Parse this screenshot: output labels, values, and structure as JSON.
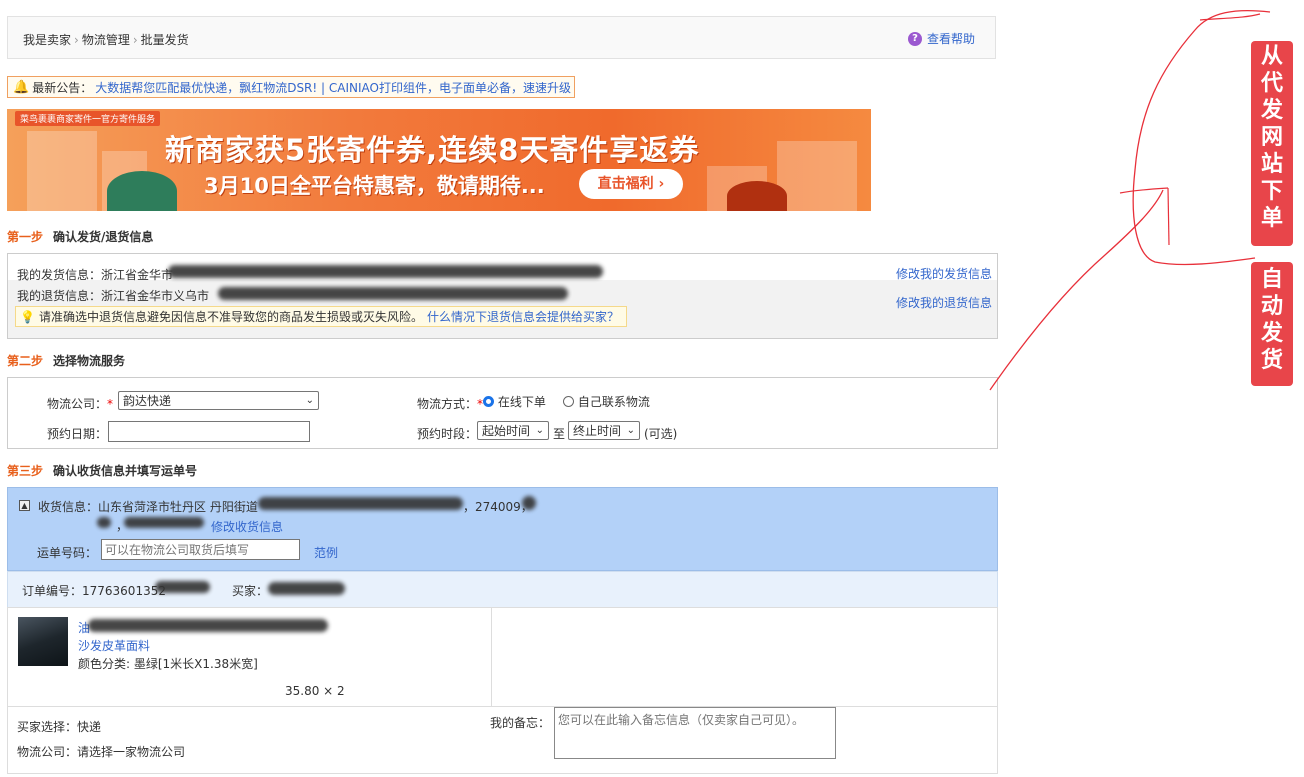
{
  "breadcrumb": [
    "我是卖家",
    "物流管理",
    "批量发货"
  ],
  "breadcrumb_sep": "›",
  "help": "查看帮助",
  "notice": {
    "prefix": "最新公告：",
    "text": "大数据帮您匹配最优快递，飘红物流DSR! | CAINIAO打印组件，电子面单必备，速速升级"
  },
  "banner": {
    "tag": "菜鸟裹裹商家寄件一官方寄件服务",
    "main": "新商家获5张寄件券,连续8天寄件享返券",
    "sub": "3月10日全平台特惠寄，敬请期待...",
    "button": "直击福利 ›"
  },
  "step1": {
    "num": "第一步",
    "title": "确认发货/退货信息",
    "ship_label": "我的发货信息：浙江省金华市",
    "return_label": "我的退货信息：浙江省金华市义乌市",
    "ship_edit": "修改我的发货信息",
    "return_edit": "修改我的退货信息",
    "tip": "请准确选中退货信息避免因信息不准导致您的商品发生损毁或灭失风险。",
    "tip_link": "什么情况下退货信息会提供给买家？"
  },
  "step2": {
    "num": "第二步",
    "title": "选择物流服务",
    "company_label": "物流公司：",
    "company_value": "韵达快递",
    "method_label": "物流方式：",
    "method_online": "在线下单",
    "method_self": "自己联系物流",
    "date_label": "预约日期：",
    "time_label": "预约时段：",
    "time_start": "起始时间",
    "time_to": "至",
    "time_end": "终止时间",
    "time_optional": "(可选)",
    "req": "*"
  },
  "step3": {
    "num": "第三步",
    "title": "确认收货信息并填写运单号",
    "recv_label": "收货信息：山东省菏泽市牡丹区 丹阳街道",
    "recv_zip": "，274009，",
    "recv_comma": "，",
    "recv_edit": "修改收货信息",
    "waybill_label": "运单号码：",
    "waybill_placeholder": "可以在物流公司取货后填写",
    "example": "范例",
    "order_label": "订单编号：17763601352",
    "buyer_label": "买家：",
    "item_title_start": "油",
    "item_title_2": "沙发皮革面料",
    "item_sku": "颜色分类: 墨绿[1米长X1.38米宽]",
    "item_price": "35.80 × 2",
    "buyer_choice": "买家选择：快递",
    "logistics": "物流公司：请选择一家物流公司",
    "memo_label": "我的备忘：",
    "memo_placeholder": "您可以在此输入备忘信息（仅卖家自己可见）。"
  },
  "annotations": {
    "tag1": [
      "从",
      "代",
      "发",
      "网",
      "站",
      "下",
      "单"
    ],
    "tag2": [
      "自",
      "动",
      "发",
      "货"
    ],
    "color": "#e8454a"
  }
}
